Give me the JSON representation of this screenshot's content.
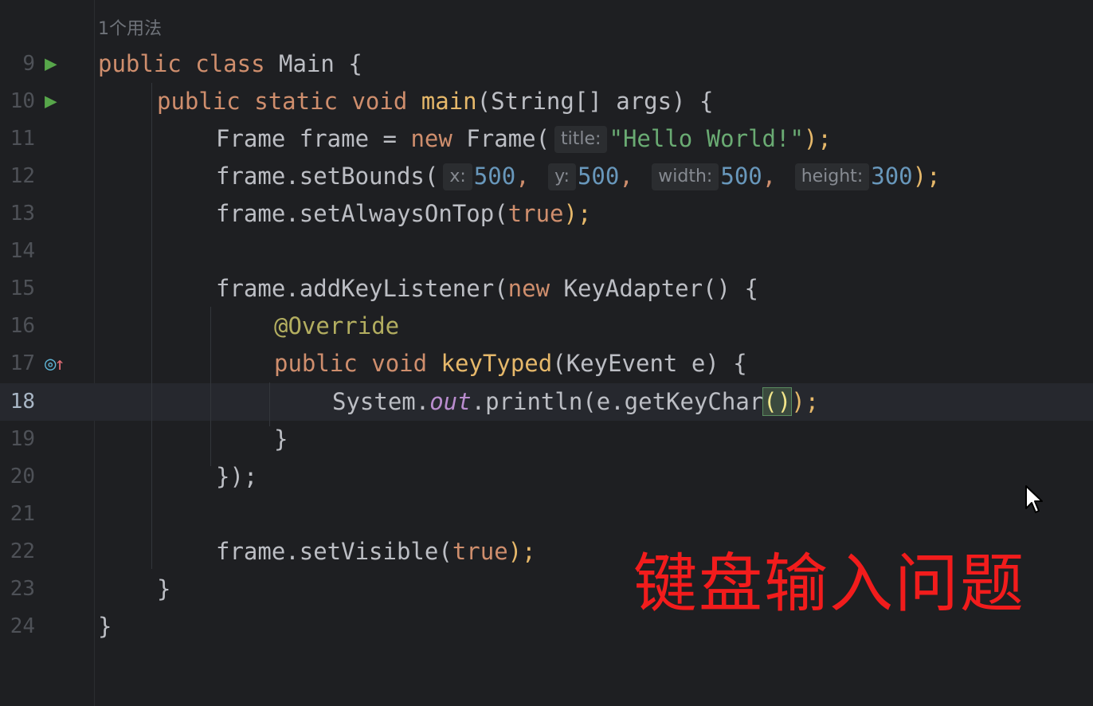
{
  "editor": {
    "usage_hint": "1个用法",
    "current_line": "18",
    "lines": [
      {
        "num": "9"
      },
      {
        "num": "10"
      },
      {
        "num": "11"
      },
      {
        "num": "12"
      },
      {
        "num": "13"
      },
      {
        "num": "14"
      },
      {
        "num": "15"
      },
      {
        "num": "16"
      },
      {
        "num": "17"
      },
      {
        "num": "18"
      },
      {
        "num": "19"
      },
      {
        "num": "20"
      },
      {
        "num": "21"
      },
      {
        "num": "22"
      },
      {
        "num": "23"
      },
      {
        "num": "24"
      }
    ],
    "hints": {
      "title": "title:",
      "x": "x:",
      "y": "y:",
      "width": "width:",
      "height": "height:"
    },
    "code": {
      "l9": {
        "kw1": "public",
        "kw2": "class",
        "name": "Main",
        "brace": "{"
      },
      "l10": {
        "kw1": "public",
        "kw2": "static",
        "kw3": "void",
        "fn": "main",
        "rest": "(String[] args) {"
      },
      "l11": {
        "a": "Frame frame = ",
        "kw": "new",
        "b": " Frame(",
        "str": "\"Hello World!\"",
        "end": ");"
      },
      "l12": {
        "a": "frame.setBounds(",
        "n1": "500",
        "n2": "500",
        "n3": "500",
        "n4": "300",
        "end": ");"
      },
      "l13": {
        "a": "frame.setAlwaysOnTop(",
        "kw": "true",
        "end": ");"
      },
      "l15": {
        "a": "frame.addKeyListener(",
        "kw": "new",
        "b": " KeyAdapter() {"
      },
      "l16": {
        "ann": "@Override"
      },
      "l17": {
        "kw1": "public",
        "kw2": "void",
        "fn": "keyTyped",
        "rest": "(KeyEvent e) {"
      },
      "l18": {
        "a": "System.",
        "field": "out",
        "b": ".println(e.getKeyChar",
        "paren": "()",
        "end": ");"
      },
      "l19": {
        "brace": "}"
      },
      "l20": {
        "a": "});"
      },
      "l22": {
        "a": "frame.setVisible(",
        "kw": "true",
        "end": ");"
      },
      "l23": {
        "brace": "}"
      },
      "l24": {
        "brace": "}"
      }
    }
  },
  "overlay": {
    "text": "键盘输入问题",
    "color": "#f21c1c"
  },
  "colors": {
    "background": "#1e1f22",
    "keyword": "#cf8e6d",
    "function": "#e6b86a",
    "string": "#6aab73",
    "number": "#6897bb",
    "annotation": "#b3ae60",
    "run_icon": "#57a64a"
  },
  "icons": {
    "run": "run-gutter-icon",
    "override": "override-gutter-icon",
    "cursor": "mouse-pointer-icon"
  }
}
